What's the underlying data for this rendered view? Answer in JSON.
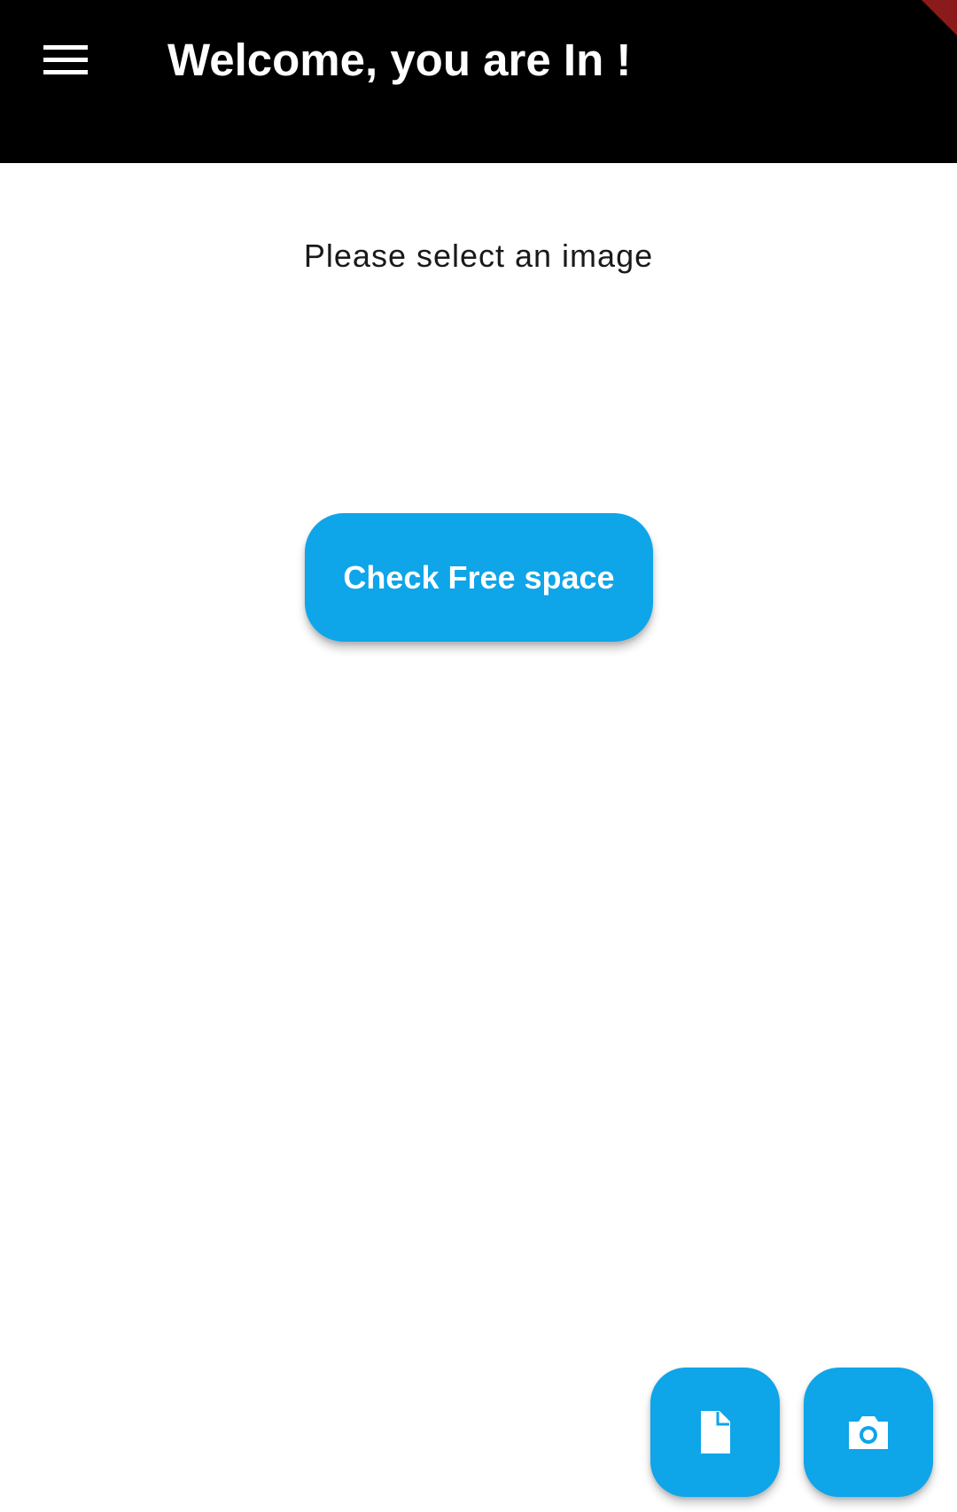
{
  "app_bar": {
    "title": "Welcome, you are In !",
    "menu_icon": "hamburger-menu-icon",
    "background": "#000000"
  },
  "main": {
    "prompt": "Please select an image",
    "check_button_label": "Check Free space",
    "accent_color": "#0ea5e9"
  },
  "fabs": [
    {
      "icon": "file-icon"
    },
    {
      "icon": "camera-icon"
    }
  ]
}
